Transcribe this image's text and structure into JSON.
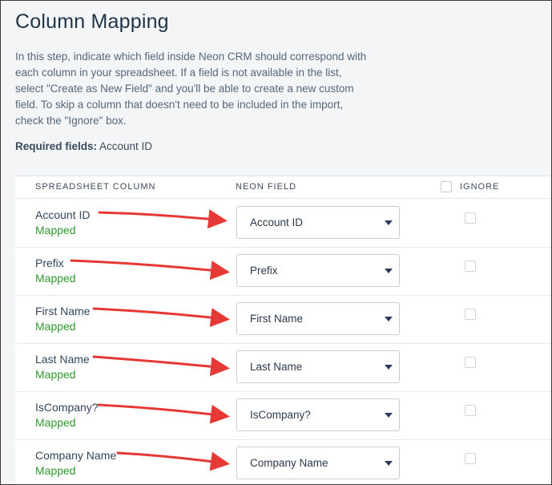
{
  "page": {
    "title": "Column Mapping",
    "description": "In this step, indicate which field inside Neon CRM should correspond with each column in your spreadsheet. If a field is not available in the list, select \"Create as New Field\" and you'll be able to create a new custom field. To skip a column that doesn't need to be included in the import, check the \"Ignore\" box.",
    "required_label": "Required fields:",
    "required_value": " Account ID"
  },
  "table": {
    "headers": {
      "spreadsheet_column": "SPREADSHEET COLUMN",
      "neon_field": "NEON FIELD",
      "ignore": "IGNORE"
    },
    "rows": [
      {
        "column": "Account ID",
        "status": "Mapped",
        "field": "Account ID",
        "ignored": false
      },
      {
        "column": "Prefix",
        "status": "Mapped",
        "field": "Prefix",
        "ignored": false
      },
      {
        "column": "First Name",
        "status": "Mapped",
        "field": "First Name",
        "ignored": false
      },
      {
        "column": "Last Name",
        "status": "Mapped",
        "field": "Last Name",
        "ignored": false
      },
      {
        "column": "IsCompany?",
        "status": "Mapped",
        "field": "IsCompany?",
        "ignored": false
      },
      {
        "column": "Company Name",
        "status": "Mapped",
        "field": "Company Name",
        "ignored": false
      }
    ]
  },
  "colors": {
    "mapped": "#2f9a2f",
    "annotation_arrow": "#e53935",
    "title": "#1f3447"
  }
}
